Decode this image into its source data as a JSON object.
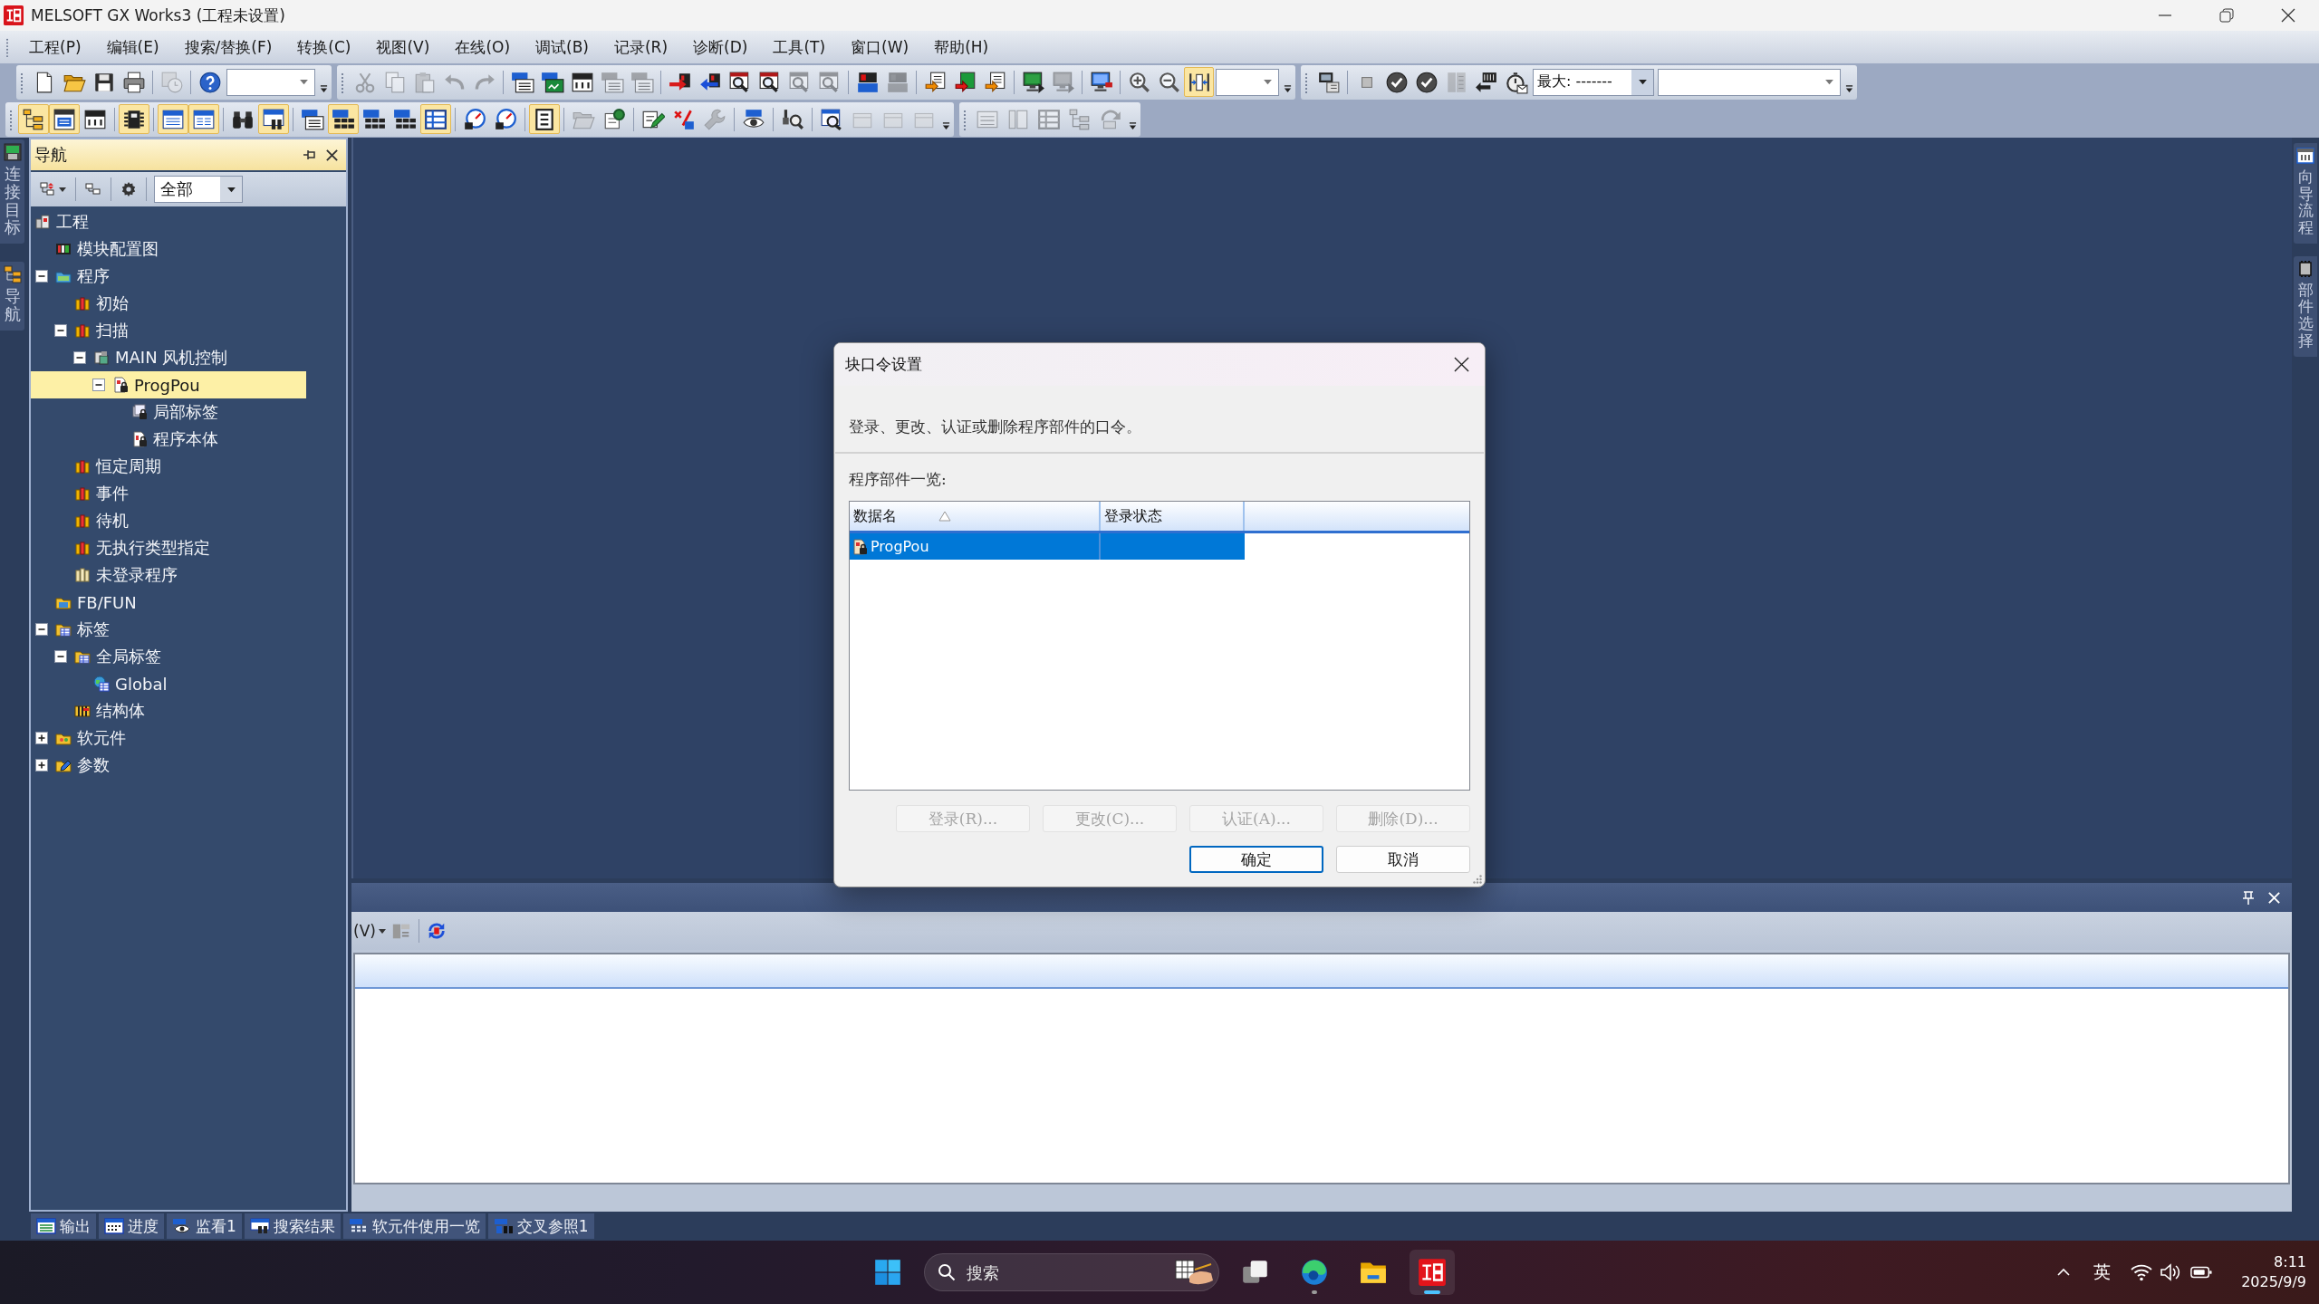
{
  "window": {
    "title": "MELSOFT GX Works3 (工程未设置)"
  },
  "menu": [
    "工程(P)",
    "编辑(E)",
    "搜索/替换(F)",
    "转换(C)",
    "视图(V)",
    "在线(O)",
    "调试(B)",
    "记录(R)",
    "诊断(D)",
    "工具(T)",
    "窗口(W)",
    "帮助(H)"
  ],
  "toolbars": [
    {
      "groups": [
        {
          "items": [
            {
              "kind": "new",
              "on": false,
              "disabled": false
            },
            {
              "kind": "open",
              "on": false,
              "disabled": false
            },
            {
              "kind": "save",
              "on": false,
              "disabled": false
            },
            {
              "kind": "print",
              "on": false,
              "disabled": false
            },
            {
              "kind": "separator"
            },
            {
              "kind": "clock",
              "on": false,
              "disabled": true
            },
            {
              "kind": "separator"
            },
            {
              "kind": "help",
              "on": false,
              "disabled": false
            },
            {
              "kind": "combo"
            }
          ]
        },
        {
          "items": [
            {
              "kind": "cut",
              "on": false,
              "disabled": true
            },
            {
              "kind": "copy",
              "on": false,
              "disabled": true
            },
            {
              "kind": "paste",
              "on": false,
              "disabled": true
            },
            {
              "kind": "undo",
              "on": false,
              "disabled": true
            },
            {
              "kind": "redo",
              "on": false,
              "disabled": true
            },
            {
              "kind": "separator"
            },
            {
              "kind": "devwin",
              "on": false,
              "disabled": false
            },
            {
              "kind": "devmon",
              "on": false,
              "disabled": false
            },
            {
              "kind": "hk",
              "on": false,
              "disabled": false
            },
            {
              "kind": "devwin",
              "on": false,
              "disabled": true
            },
            {
              "kind": "devwin",
              "on": false,
              "disabled": true
            },
            {
              "kind": "separator"
            },
            {
              "kind": "transfer",
              "on": false,
              "disabled": false
            },
            {
              "kind": "transferback",
              "on": false,
              "disabled": false
            },
            {
              "kind": "findwin",
              "on": false,
              "disabled": false
            },
            {
              "kind": "findwin",
              "on": false,
              "disabled": false
            },
            {
              "kind": "findwin",
              "on": false,
              "disabled": true
            },
            {
              "kind": "findwin",
              "on": false,
              "disabled": true
            },
            {
              "kind": "separator"
            },
            {
              "kind": "devred",
              "on": false,
              "disabled": false
            },
            {
              "kind": "devred",
              "on": false,
              "disabled": true
            },
            {
              "kind": "separator"
            },
            {
              "kind": "writeorange",
              "on": false,
              "disabled": false
            },
            {
              "kind": "writered",
              "on": false,
              "disabled": false
            },
            {
              "kind": "writeorange",
              "on": false,
              "disabled": false
            },
            {
              "kind": "separator"
            },
            {
              "kind": "monitor",
              "on": false,
              "disabled": false
            },
            {
              "kind": "monitor",
              "on": false,
              "disabled": true
            },
            {
              "kind": "separator"
            },
            {
              "kind": "monitoralt",
              "on": false,
              "disabled": false
            },
            {
              "kind": "separator"
            },
            {
              "kind": "zoomin",
              "on": false,
              "disabled": false
            },
            {
              "kind": "zoomout",
              "on": false,
              "disabled": false
            },
            {
              "kind": "fit",
              "on": true,
              "disabled": false
            },
            {
              "kind": "combo"
            }
          ]
        },
        {
          "items": [
            {
              "kind": "pcwrite",
              "on": false,
              "disabled": false
            },
            {
              "kind": "separator"
            },
            {
              "kind": "stop",
              "on": false,
              "disabled": false
            },
            {
              "kind": "check",
              "on": false,
              "disabled": false
            },
            {
              "kind": "check",
              "on": false,
              "disabled": false
            },
            {
              "kind": "module",
              "on": false,
              "disabled": true
            },
            {
              "kind": "transferdark",
              "on": false,
              "disabled": false
            },
            {
              "kind": "stopwatch",
              "on": false,
              "disabled": false
            },
            {
              "kind": "combo",
              "value": "最大: -------"
            },
            {
              "kind": "combo"
            }
          ]
        }
      ]
    },
    {
      "groups": [
        {
          "items": [
            {
              "kind": "tree",
              "on": true,
              "disabled": false
            },
            {
              "kind": "printwin",
              "on": true,
              "disabled": false
            },
            {
              "kind": "hk",
              "on": false,
              "disabled": false
            },
            {
              "kind": "separator"
            },
            {
              "kind": "chip",
              "on": true,
              "disabled": false
            },
            {
              "kind": "separator"
            },
            {
              "kind": "window",
              "on": true,
              "disabled": false
            },
            {
              "kind": "window2",
              "on": true,
              "disabled": false
            },
            {
              "kind": "separator"
            },
            {
              "kind": "binoculars",
              "on": false,
              "disabled": false
            },
            {
              "kind": "windowfind",
              "on": true,
              "disabled": false
            },
            {
              "kind": "separator"
            },
            {
              "kind": "devwin",
              "on": false,
              "disabled": false
            },
            {
              "kind": "devlist",
              "on": true,
              "disabled": false
            },
            {
              "kind": "devlist",
              "on": false,
              "disabled": false
            },
            {
              "kind": "devlist",
              "on": false,
              "disabled": false
            },
            {
              "kind": "table",
              "on": true,
              "disabled": false
            },
            {
              "kind": "separator"
            },
            {
              "kind": "gauge",
              "on": false,
              "disabled": false
            },
            {
              "kind": "gauge",
              "on": false,
              "disabled": false
            },
            {
              "kind": "separator"
            },
            {
              "kind": "listbox",
              "on": true,
              "disabled": false
            },
            {
              "kind": "separator"
            },
            {
              "kind": "open",
              "on": false,
              "disabled": true
            },
            {
              "kind": "gearedit",
              "on": false,
              "disabled": false
            },
            {
              "kind": "separator"
            },
            {
              "kind": "pencil",
              "on": false,
              "disabled": false
            },
            {
              "kind": "editred",
              "on": false,
              "disabled": false
            },
            {
              "kind": "wrench",
              "on": false,
              "disabled": true
            },
            {
              "kind": "separator"
            },
            {
              "kind": "eye",
              "on": false,
              "disabled": false
            },
            {
              "kind": "separator"
            },
            {
              "kind": "probe",
              "on": false,
              "disabled": false
            },
            {
              "kind": "separator"
            },
            {
              "kind": "winsearch",
              "on": false,
              "disabled": false
            },
            {
              "kind": "box",
              "on": false,
              "disabled": true
            },
            {
              "kind": "box",
              "on": false,
              "disabled": true
            },
            {
              "kind": "box",
              "on": false,
              "disabled": true
            }
          ]
        },
        {
          "items": [
            {
              "kind": "listwin",
              "on": false,
              "disabled": true
            },
            {
              "kind": "column",
              "on": false,
              "disabled": true
            },
            {
              "kind": "table",
              "on": false,
              "disabled": true
            },
            {
              "kind": "tree",
              "on": false,
              "disabled": true
            },
            {
              "kind": "rotate",
              "on": false,
              "disabled": true
            }
          ]
        }
      ]
    }
  ],
  "left_tabs": [
    {
      "label": "连接目标",
      "kind": "connection"
    },
    {
      "label": "导航",
      "kind": "navigation"
    }
  ],
  "navigation": {
    "title": "导航",
    "filter": "全部",
    "tree": [
      {
        "label": "工程",
        "kind": "project",
        "selected": false,
        "children": [
          {
            "label": "模块配置图",
            "kind": "module",
            "selected": false
          },
          {
            "label": "程序",
            "kind": "programs",
            "expanded": true,
            "selected": false,
            "children": [
              {
                "label": "初始",
                "kind": "task",
                "selected": false
              },
              {
                "label": "扫描",
                "kind": "task",
                "expanded": true,
                "selected": false,
                "children": [
                  {
                    "label": "MAIN 风机控制",
                    "kind": "program",
                    "expanded": true,
                    "selected": false,
                    "children": [
                      {
                        "label": "ProgPou",
                        "kind": "pou",
                        "expanded": true,
                        "selected": true,
                        "children": [
                          {
                            "label": "局部标签",
                            "kind": "labels",
                            "selected": false
                          },
                          {
                            "label": "程序本体",
                            "kind": "body",
                            "selected": false
                          }
                        ]
                      }
                    ]
                  }
                ]
              },
              {
                "label": "恒定周期",
                "kind": "task",
                "selected": false
              },
              {
                "label": "事件",
                "kind": "task",
                "selected": false
              },
              {
                "label": "待机",
                "kind": "task",
                "selected": false
              },
              {
                "label": "无执行类型指定",
                "kind": "task",
                "selected": false
              },
              {
                "label": "未登录程序",
                "kind": "unregistered",
                "selected": false
              }
            ]
          },
          {
            "label": "FB/FUN",
            "kind": "fbfun",
            "selected": false
          },
          {
            "label": "标签",
            "kind": "labelfolder",
            "expanded": true,
            "selected": false,
            "children": [
              {
                "label": "全局标签",
                "kind": "labelfolder",
                "expanded": true,
                "selected": false,
                "children": [
                  {
                    "label": "Global",
                    "kind": "global",
                    "selected": false
                  }
                ]
              },
              {
                "label": "结构体",
                "kind": "struct",
                "selected": false
              }
            ]
          },
          {
            "label": "软元件",
            "kind": "device",
            "expanded": false,
            "selected": false
          },
          {
            "label": "参数",
            "kind": "parameter",
            "expanded": false,
            "selected": false
          }
        ]
      }
    ]
  },
  "output_panel": {
    "menu_label": "(V)"
  },
  "right_tabs": [
    {
      "label": "向导流程",
      "kind": "wizard"
    },
    {
      "label": "部件选择",
      "kind": "parts"
    }
  ],
  "bottom_tabs": [
    {
      "label": "输出",
      "kind": "output"
    },
    {
      "label": "进度",
      "kind": "progress"
    },
    {
      "label": "监看1",
      "kind": "watch"
    },
    {
      "label": "搜索结果",
      "kind": "search"
    },
    {
      "label": "软元件使用一览",
      "kind": "devicelist"
    },
    {
      "label": "交叉参照1",
      "kind": "crossref"
    }
  ],
  "dialog": {
    "title": "块口令设置",
    "description": "登录、更改、认证或删除程序部件的口令。",
    "list_label": "程序部件一览:",
    "columns": [
      {
        "label": "数据名",
        "sorted": true
      },
      {
        "label": "登录状态",
        "sorted": false
      }
    ],
    "rows": [
      {
        "name": "ProgPou",
        "selected": true
      }
    ],
    "actions": [
      {
        "label": "登录(R)...",
        "disabled": true
      },
      {
        "label": "更改(C)...",
        "disabled": true
      },
      {
        "label": "认证(A)...",
        "disabled": true
      },
      {
        "label": "删除(D)...",
        "disabled": true
      }
    ],
    "footer": [
      {
        "label": "确定",
        "default": true
      },
      {
        "label": "取消",
        "default": false
      }
    ]
  },
  "taskbar": {
    "search_placeholder": "搜索",
    "apps": [
      {
        "kind": "taskview",
        "running": false,
        "active": false
      },
      {
        "kind": "edge",
        "running": true,
        "active": false
      },
      {
        "kind": "explorer",
        "running": false,
        "active": false
      },
      {
        "kind": "gxworks",
        "running": true,
        "active": true
      }
    ],
    "input_method": "英",
    "time": "8:11",
    "date": "2025/9/9"
  }
}
